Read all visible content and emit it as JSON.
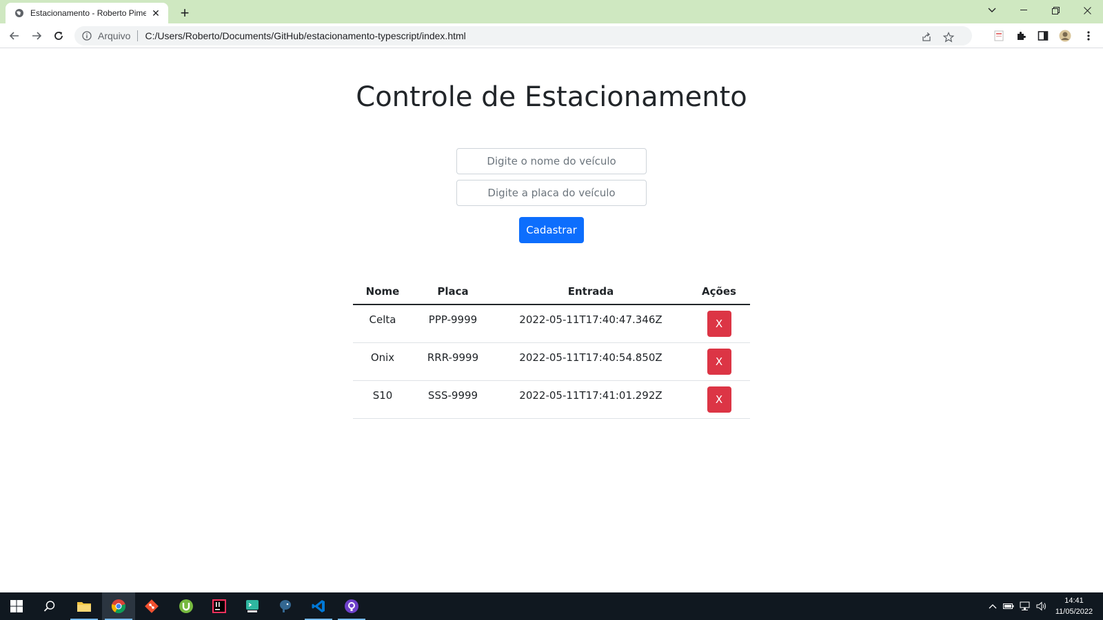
{
  "browser": {
    "tab_title": "Estacionamento - Roberto Pimentel",
    "address_scheme_label": "Arquivo",
    "url": "C:/Users/Roberto/Documents/GitHub/estacionamento-typescript/index.html"
  },
  "page": {
    "title": "Controle de Estacionamento",
    "name_placeholder": "Digite o nome do veículo",
    "plate_placeholder": "Digite a placa do veículo",
    "submit_label": "Cadastrar"
  },
  "table": {
    "headers": [
      "Nome",
      "Placa",
      "Entrada",
      "Ações"
    ],
    "rows": [
      {
        "nome": "Celta",
        "placa": "PPP-9999",
        "entrada": "2022-05-11T17:40:47.346Z",
        "acao": "X"
      },
      {
        "nome": "Onix",
        "placa": "RRR-9999",
        "entrada": "2022-05-11T17:40:54.850Z",
        "acao": "X"
      },
      {
        "nome": "S10",
        "placa": "SSS-9999",
        "entrada": "2022-05-11T17:41:01.292Z",
        "acao": "X"
      }
    ]
  },
  "taskbar": {
    "time": "14:41",
    "date": "11/05/2022",
    "apps": [
      "start-icon",
      "search-icon",
      "file-explorer-icon",
      "chrome-icon",
      "git-icon",
      "utorrent-icon",
      "intellij-icon",
      "terminal-icon",
      "postgres-icon",
      "vscode-icon",
      "github-desktop-icon"
    ]
  },
  "colors": {
    "primary": "#0d6efd",
    "danger": "#dc3545",
    "tabstrip": "#cfe8c1"
  }
}
